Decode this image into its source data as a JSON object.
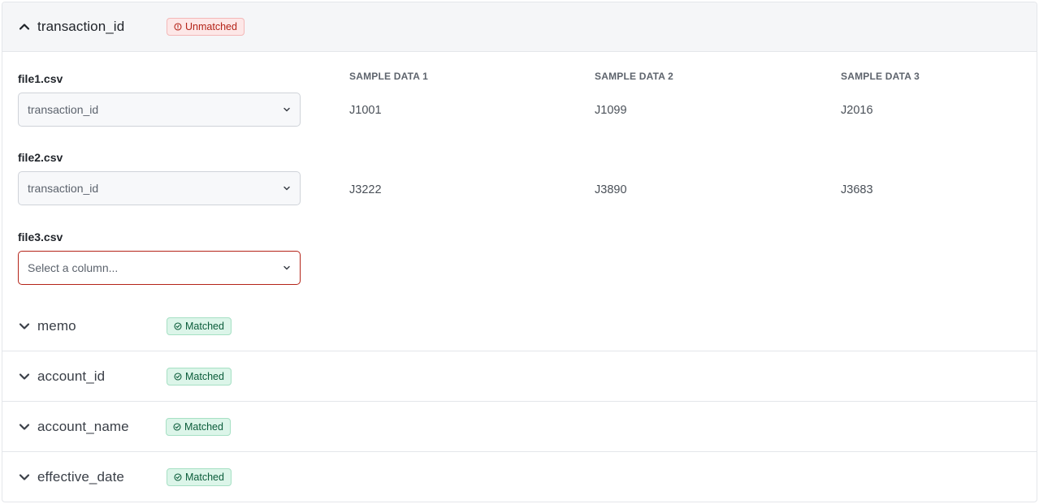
{
  "expanded_section": {
    "field": "transaction_id",
    "badge": "Unmatched",
    "column_headers": [
      "SAMPLE DATA 1",
      "SAMPLE DATA 2",
      "SAMPLE DATA 3"
    ],
    "files": [
      {
        "name": "file1.csv",
        "selected": "transaction_id",
        "samples": [
          "J1001",
          "J1099",
          "J2016"
        ]
      },
      {
        "name": "file2.csv",
        "selected": "transaction_id",
        "samples": [
          "J3222",
          "J3890",
          "J3683"
        ]
      },
      {
        "name": "file3.csv",
        "placeholder": "Select a column...",
        "samples": []
      }
    ]
  },
  "collapsed_sections": [
    {
      "field": "memo",
      "badge": "Matched"
    },
    {
      "field": "account_id",
      "badge": "Matched"
    },
    {
      "field": "account_name",
      "badge": "Matched"
    },
    {
      "field": "effective_date",
      "badge": "Matched"
    }
  ],
  "colors": {
    "unmatched": "#b42318",
    "matched": "#0b5c3a",
    "error_border": "#b42318"
  },
  "icons": {
    "expanded": "chevron-up-icon",
    "collapsed": "chevron-down-icon",
    "unmatched": "alert-circle-icon",
    "matched": "check-circle-icon",
    "select": "caret-down-icon"
  }
}
